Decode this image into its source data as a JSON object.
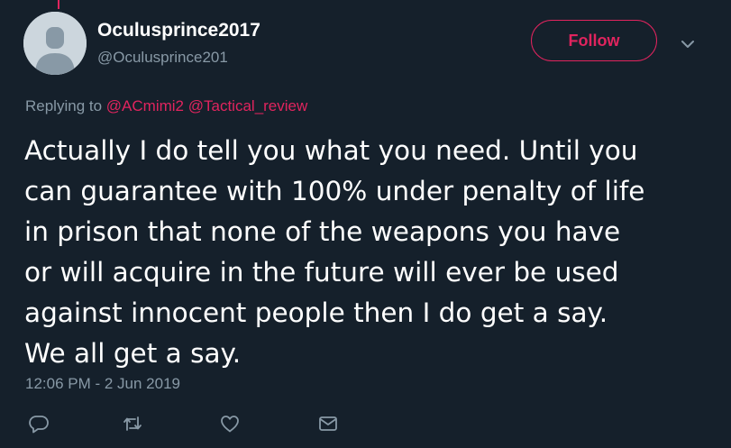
{
  "author": {
    "display_name": "Oculusprince2017",
    "handle": "@Oculusprince201"
  },
  "follow_label": "Follow",
  "reply": {
    "prefix": "Replying to",
    "mentions": [
      "@ACmimi2",
      "@Tactical_review"
    ]
  },
  "tweet": {
    "lines": [
      "Actually I do tell you what you need. Until you",
      "can guarantee with 100% under penalty of life",
      "in prison that none of the weapons you have",
      "or will acquire in the future will ever be used",
      "against innocent people then I do get a say.",
      "We all get a say."
    ]
  },
  "timestamp": "12:06 PM - 2 Jun 2019",
  "actions": [
    "reply-icon",
    "retweet-icon",
    "like-icon",
    "message-icon"
  ],
  "colors": {
    "background": "#15202b",
    "accent": "#e0245e",
    "secondary_text": "#8899a6",
    "text": "#ffffff"
  }
}
